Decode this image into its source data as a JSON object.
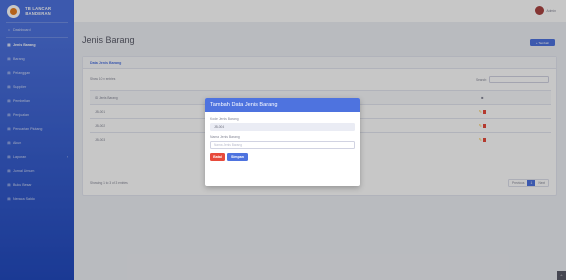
{
  "brand": {
    "line1": "TB LANCAR",
    "line2": "BANDERAN"
  },
  "sidebar": {
    "items": [
      {
        "icon": "⌂",
        "label": "Dashboard",
        "active": false
      },
      {
        "icon": "▤",
        "label": "Jenis Barang",
        "active": true
      },
      {
        "icon": "▤",
        "label": "Barang",
        "active": false
      },
      {
        "icon": "▤",
        "label": "Pelanggan",
        "active": false
      },
      {
        "icon": "▤",
        "label": "Supplier",
        "active": false
      },
      {
        "icon": "▤",
        "label": "Pembelian",
        "active": false
      },
      {
        "icon": "▤",
        "label": "Penjualan",
        "active": false
      },
      {
        "icon": "▤",
        "label": "Pencarian Piutang",
        "active": false
      },
      {
        "icon": "▤",
        "label": "Akun",
        "active": false
      },
      {
        "icon": "▤",
        "label": "Laporan",
        "active": false
      },
      {
        "icon": "▤",
        "label": "Jurnal Umum",
        "active": false
      },
      {
        "icon": "▤",
        "label": "Buku Besar",
        "active": false
      },
      {
        "icon": "▤",
        "label": "Neraca Saldo",
        "active": false
      }
    ]
  },
  "user": {
    "name": "Admin"
  },
  "page": {
    "title": "Jenis Barang",
    "add_label": "+ Tambah"
  },
  "card": {
    "header": "Data Jenis Barang",
    "show_entries": "Show 10 ▾ entries",
    "search_label": "Search:",
    "columns": [
      "ID Jenis Barang",
      "Aksi"
    ],
    "rows": [
      {
        "id": "JB-001"
      },
      {
        "id": "JB-002"
      },
      {
        "id": "JB-003"
      }
    ],
    "info": "Showing 1 to 3 of 3 entries",
    "pager": {
      "prev": "Previous",
      "current": "1",
      "next": "Next"
    }
  },
  "modal": {
    "title": "Tambah Data Jenis Barang",
    "kode_label": "Kode Jenis Barang",
    "kode_value": "JB-004",
    "nama_label": "Nama Jenis Barang",
    "nama_placeholder": "Nama Jenis Barang",
    "batal_label": "Batal",
    "simpan_label": "Simpan"
  },
  "colors": {
    "primary": "#4e73df",
    "danger": "#e74a3b",
    "warning": "#f6c23e"
  }
}
